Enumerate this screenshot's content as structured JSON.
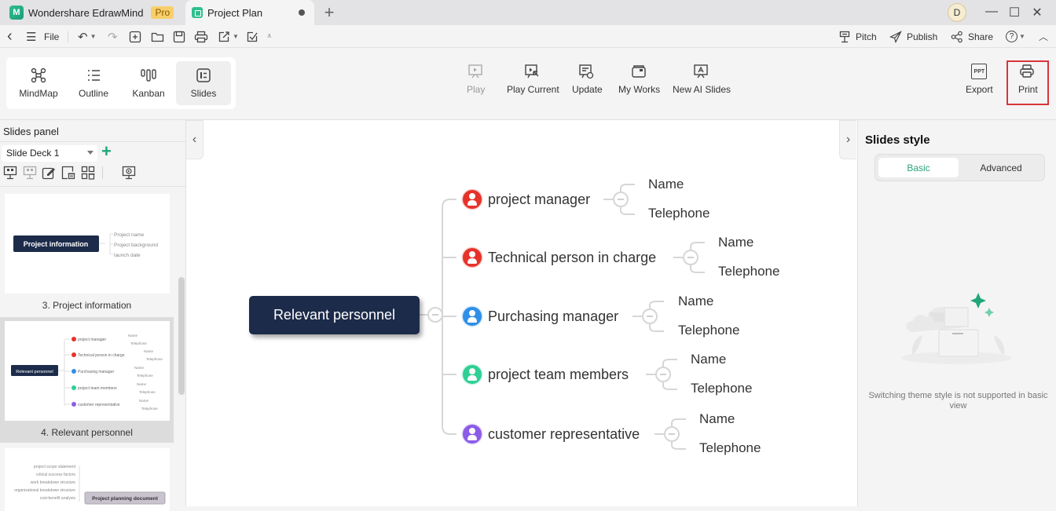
{
  "titlebar": {
    "app_name": "Wondershare EdrawMind",
    "app_logo_letter": "M",
    "pro_badge": "Pro",
    "doc_tab": "Project Plan",
    "new_tab": "+",
    "user_initial": "D",
    "minimize": "—",
    "maximize": "☐",
    "close": "✕"
  },
  "toolbar": {
    "back": "‹",
    "menu": "☰",
    "file": "File",
    "undo": "↶",
    "redo": "↷",
    "pitch": "Pitch",
    "publish": "Publish",
    "share": "Share",
    "help": "?",
    "collapse": "︿"
  },
  "views": [
    {
      "label": "MindMap",
      "icon": "mindmap-icon",
      "active": false
    },
    {
      "label": "Outline",
      "icon": "outline-icon",
      "active": false
    },
    {
      "label": "Kanban",
      "icon": "kanban-icon",
      "active": false
    },
    {
      "label": "Slides",
      "icon": "slides-icon",
      "active": true
    }
  ],
  "ribbon": {
    "play": "Play",
    "play_current": "Play Current",
    "update": "Update",
    "my_works": "My Works",
    "new_ai_slides": "New AI Slides",
    "export": "Export",
    "export_icon_text": "PPT",
    "print": "Print"
  },
  "left_panel": {
    "title": "Slides panel",
    "deck": "Slide Deck 1",
    "add": "+",
    "slides": [
      {
        "label": "3. Project information",
        "root": "Project information",
        "children": [
          "Project name",
          "Project background",
          "launch date"
        ]
      },
      {
        "label": "4. Relevant personnel",
        "selected": true,
        "root": "Relevant personnel",
        "children": [
          "project manager",
          "Technical person in charge",
          "Purchasing manager",
          "project team members",
          "customer representative"
        ],
        "leaf1": "Name",
        "leaf2": "Telephone"
      },
      {
        "label": "",
        "root": "Project planning document",
        "children": [
          "project scope statement",
          "critical success factors",
          "work breakdown structure",
          "organizational breakdown structure",
          "cost-benefit analysis"
        ]
      }
    ]
  },
  "canvas": {
    "left_toggle": "‹",
    "right_toggle": "›",
    "root": "Relevant personnel",
    "branches": [
      {
        "label": "project manager",
        "color": "#e5332a",
        "leaves": [
          "Name",
          "Telephone"
        ]
      },
      {
        "label": "Technical person in charge",
        "color": "#e5332a",
        "leaves": [
          "Name",
          "Telephone"
        ]
      },
      {
        "label": "Purchasing manager",
        "color": "#2f8fe8",
        "leaves": [
          "Name",
          "Telephone"
        ]
      },
      {
        "label": "project team members",
        "color": "#2fcf95",
        "leaves": [
          "Name",
          "Telephone"
        ]
      },
      {
        "label": "customer representative",
        "color": "#8c5ce8",
        "leaves": [
          "Name",
          "Telephone"
        ]
      }
    ]
  },
  "right_panel": {
    "title": "Slides style",
    "tabs": [
      {
        "label": "Basic",
        "active": true
      },
      {
        "label": "Advanced",
        "active": false
      }
    ],
    "message": "Switching theme style is not supported in basic view"
  },
  "colors": {
    "accent": "#1fa77a",
    "root_node": "#1d2b4a",
    "highlight_border": "#d9343c"
  }
}
